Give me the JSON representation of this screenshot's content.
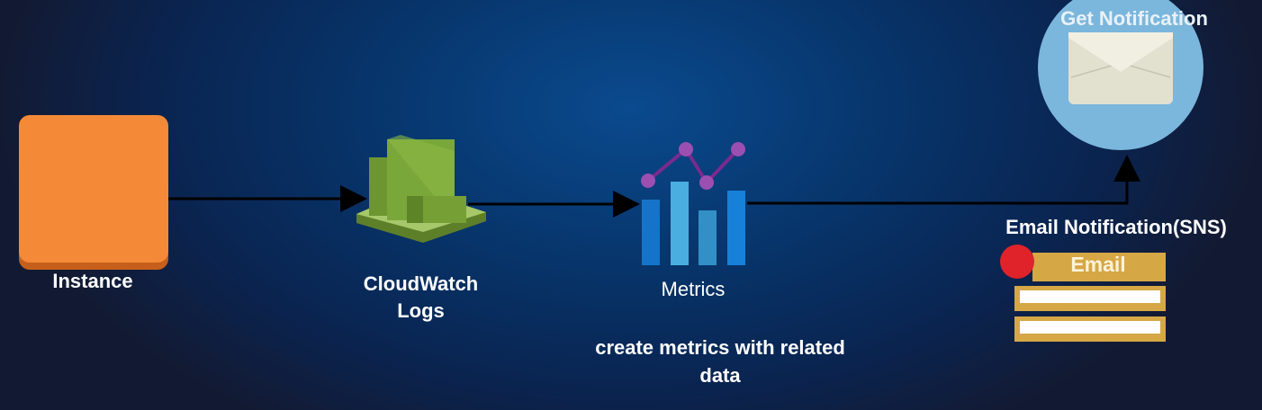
{
  "nodes": {
    "instance": {
      "label": "Instance",
      "color": "#f28a35"
    },
    "cloudwatch": {
      "label_line1": "CloudWatch",
      "label_line2": "Logs",
      "color": "#7aa13c"
    },
    "metrics": {
      "label": "Metrics",
      "note_line1": "create metrics with related",
      "note_line2": "data"
    },
    "notification": {
      "label": "Get Notification",
      "circle_color": "#7bb6dc"
    },
    "sns": {
      "label": "Email Notification(SNS)",
      "form_title": "Email",
      "form_color": "#d6a745"
    }
  }
}
